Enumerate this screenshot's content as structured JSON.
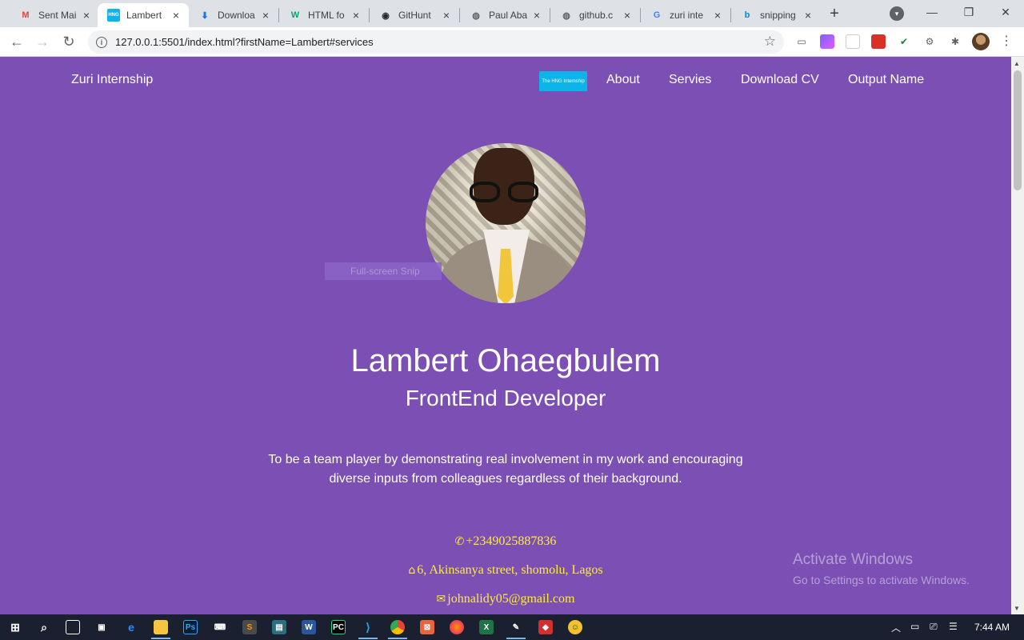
{
  "browser": {
    "tabs": [
      {
        "title": "Sent Mai",
        "icon": "gmail-icon",
        "active": false
      },
      {
        "title": "Lambert",
        "icon": "hng-icon",
        "active": true
      },
      {
        "title": "Downloa",
        "icon": "download-icon",
        "active": false
      },
      {
        "title": "HTML fo",
        "icon": "w3-icon",
        "active": false
      },
      {
        "title": "GitHunt",
        "icon": "githunt-icon",
        "active": false
      },
      {
        "title": "Paul Aba",
        "icon": "globe-icon",
        "active": false
      },
      {
        "title": "github.c",
        "icon": "globe-icon",
        "active": false
      },
      {
        "title": "zuri inte",
        "icon": "google-icon",
        "active": false
      },
      {
        "title": "snipping",
        "icon": "bing-icon",
        "active": false
      }
    ],
    "url": "127.0.0.1:5501/index.html?firstName=Lambert#services"
  },
  "nav": {
    "brand": "Zuri Internship",
    "logo_text": "The HNG Internship",
    "links": [
      "About",
      "Servies",
      "Download CV",
      "Output Name"
    ]
  },
  "profile": {
    "name": "Lambert Ohaegbulem",
    "role": "FrontEnd Developer",
    "bio_line1": "To be a team player by demonstrating real involvement in my work and encouraging",
    "bio_line2": "diverse inputs from colleagues regardless of their background.",
    "phone": "+2349025887836",
    "address": "6, Akinsanya street, shomolu, Lagos",
    "email": "johnalidy05@gmail.com"
  },
  "overlay": {
    "snip_tooltip": "Full-screen Snip"
  },
  "watermark": {
    "line1": "Activate Windows",
    "line2": "Go to Settings to activate Windows."
  },
  "taskbar": {
    "time": "7:44 AM"
  },
  "colors": {
    "page_bg": "#7b4fb4",
    "contact_text": "#ffee2e",
    "logo_bg": "#0cb4e9"
  }
}
